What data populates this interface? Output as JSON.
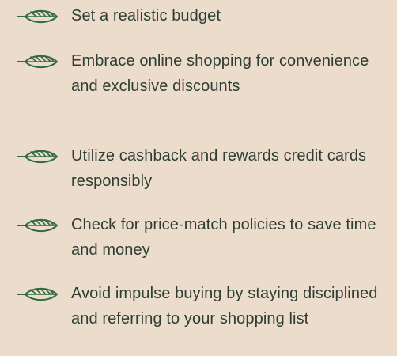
{
  "colors": {
    "background": "#ecdccc",
    "text": "#2d3e33",
    "leaf": "#2f6b3f"
  },
  "tips": [
    {
      "icon": "leaf-icon",
      "text": "Set a realistic budget"
    },
    {
      "icon": "leaf-icon",
      "text": "Embrace online shopping for convenience and exclusive discounts"
    },
    {
      "icon": "leaf-icon",
      "text": "Utilize cashback and rewards credit cards responsibly"
    },
    {
      "icon": "leaf-icon",
      "text": "Check for price-match policies to save time and money"
    },
    {
      "icon": "leaf-icon",
      "text": "Avoid impulse buying by staying disciplined and referring to your shopping list"
    }
  ]
}
